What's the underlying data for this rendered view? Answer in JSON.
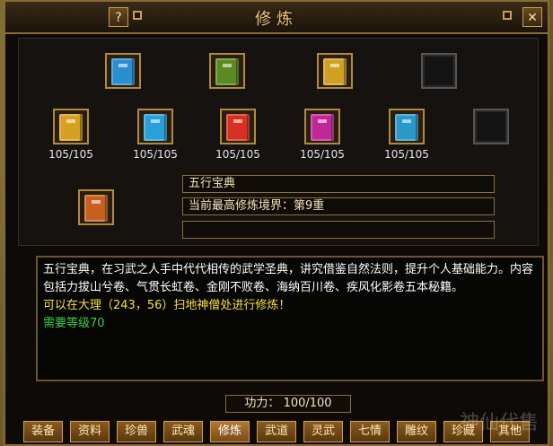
{
  "window": {
    "title": "修炼",
    "help_label": "?",
    "close_label": "✕"
  },
  "top_slots": [
    {
      "color": "#2a8fd0",
      "empty": false
    },
    {
      "color": "#5a8a20",
      "empty": false
    },
    {
      "color": "#d0a020",
      "empty": false
    },
    {
      "color": "#222222",
      "empty": true
    }
  ],
  "books": [
    {
      "color": "#d8a020",
      "count": "105/105",
      "empty": false
    },
    {
      "color": "#2aa0d8",
      "count": "105/105",
      "empty": false
    },
    {
      "color": "#d83020",
      "count": "105/105",
      "empty": false
    },
    {
      "color": "#c02898",
      "count": "105/105",
      "empty": false
    },
    {
      "color": "#2a98c8",
      "count": "105/105",
      "empty": false
    },
    {
      "color": "#222222",
      "count": "",
      "empty": true
    }
  ],
  "selected": {
    "icon_color": "#c86020",
    "name": "五行宝典",
    "realm": "当前最高修炼境界：第9重",
    "extra": ""
  },
  "description": {
    "line1": "五行宝典，在习武之人手中代代相传的武学圣典，讲究借鉴自然法则，提升个人基础能力。内容包括力拔山兮卷、气贯长虹卷、金刚不败卷、海纳百川卷、疾风化影卷五本秘籍。",
    "line2": "可以在大理（243，56）扫地神僧处进行修炼！",
    "line3": "需要等级70"
  },
  "power": {
    "label": "功力：",
    "value": "100/100"
  },
  "tabs": [
    "装备",
    "资料",
    "珍兽",
    "武魂",
    "修炼",
    "武道",
    "灵武",
    "七情",
    "雕纹",
    "珍藏",
    "其他"
  ],
  "active_tab": "修炼",
  "watermark": "神仙代售"
}
